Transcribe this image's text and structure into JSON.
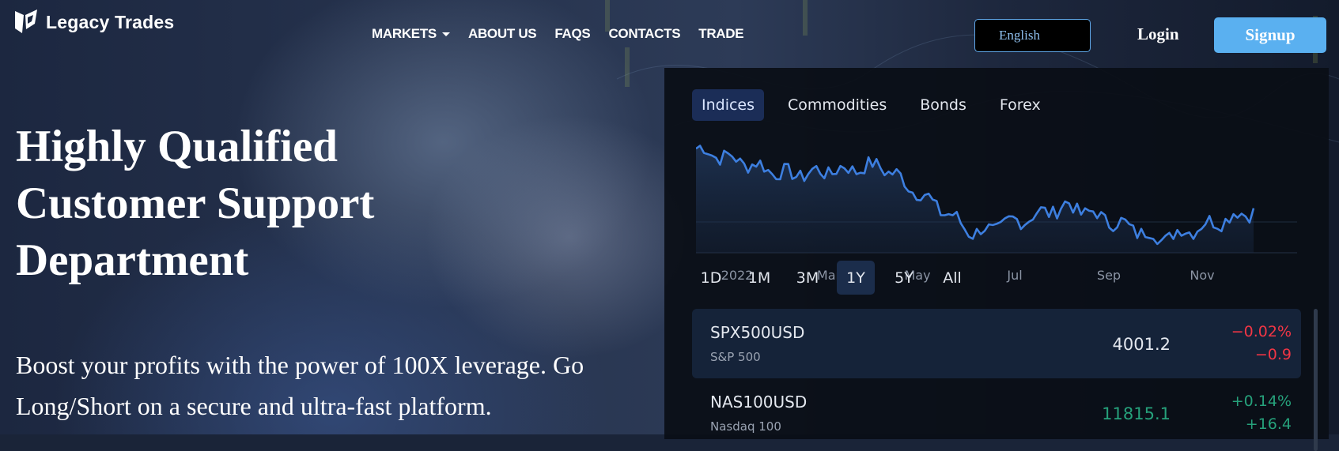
{
  "brand": {
    "name": "Legacy Trades"
  },
  "nav": {
    "items": [
      {
        "label": "MARKETS",
        "has_dropdown": true
      },
      {
        "label": "ABOUT US"
      },
      {
        "label": "FAQS"
      },
      {
        "label": "CONTACTS"
      },
      {
        "label": "TRADE"
      }
    ]
  },
  "header": {
    "language": "English",
    "login_label": "Login",
    "signup_label": "Signup"
  },
  "hero": {
    "headline": "Highly Qualified Customer Support Department",
    "subtext": "Boost your profits with the power of 100X leverage. Go Long/Short on a secure and ultra-fast platform."
  },
  "widget": {
    "tabs": [
      "Indices",
      "Commodities",
      "Bonds",
      "Forex"
    ],
    "active_tab": 0,
    "time_labels": [
      "2022",
      "Mar",
      "May",
      "Jul",
      "Sep",
      "Nov"
    ],
    "ranges": [
      "1D",
      "1M",
      "3M",
      "1Y",
      "5Y",
      "All"
    ],
    "active_range": 3,
    "quotes": [
      {
        "symbol": "SPX500USD",
        "name": "S&P 500",
        "price": "4001.2",
        "change_pct": "−0.02%",
        "change": "−0.9",
        "direction": "down"
      },
      {
        "symbol": "NAS100USD",
        "name": "Nasdaq 100",
        "price": "11815.1",
        "change_pct": "+0.14%",
        "change": "+16.4",
        "direction": "up"
      }
    ]
  },
  "colors": {
    "accent": "#5ab0f0",
    "line": "#3d7fe0",
    "down": "#f23645",
    "up": "#26a17b",
    "widget_bg": "#0a0e16"
  },
  "chart_data": {
    "type": "area",
    "x": [
      "2022",
      "Mar",
      "May",
      "Jul",
      "Sep",
      "Nov"
    ],
    "series": [
      {
        "values": [
          4700,
          4420,
          4520,
          3800,
          4100,
          3750,
          4050
        ]
      }
    ]
  }
}
